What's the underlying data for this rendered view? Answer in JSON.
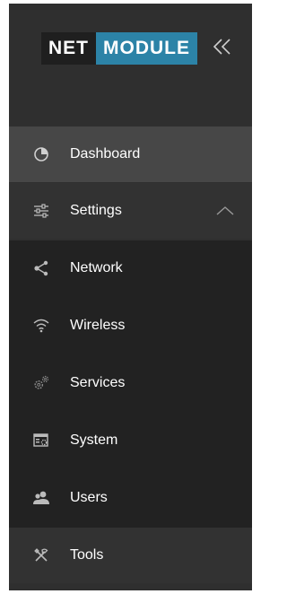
{
  "logo": {
    "net": "NET",
    "module": "MODULE"
  },
  "nav": {
    "dashboard": "Dashboard",
    "settings": "Settings",
    "network": "Network",
    "wireless": "Wireless",
    "services": "Services",
    "system": "System",
    "users": "Users",
    "tools": "Tools"
  },
  "colors": {
    "sidebar_bg": "#2f2f2f",
    "active_bg": "#474747",
    "submenu_bg": "#222222",
    "brand_blue": "#2c83a7",
    "text": "#ffffff",
    "icon": "#bbbbbb"
  },
  "icons": {
    "collapse": "double-chevron-left-icon",
    "dashboard": "pie-chart-icon",
    "settings": "sliders-icon",
    "settings_state": "chevron-up-icon",
    "network": "share-icon",
    "wireless": "wifi-icon",
    "services": "gears-icon",
    "system": "window-settings-icon",
    "users": "users-icon",
    "tools": "tools-icon"
  }
}
